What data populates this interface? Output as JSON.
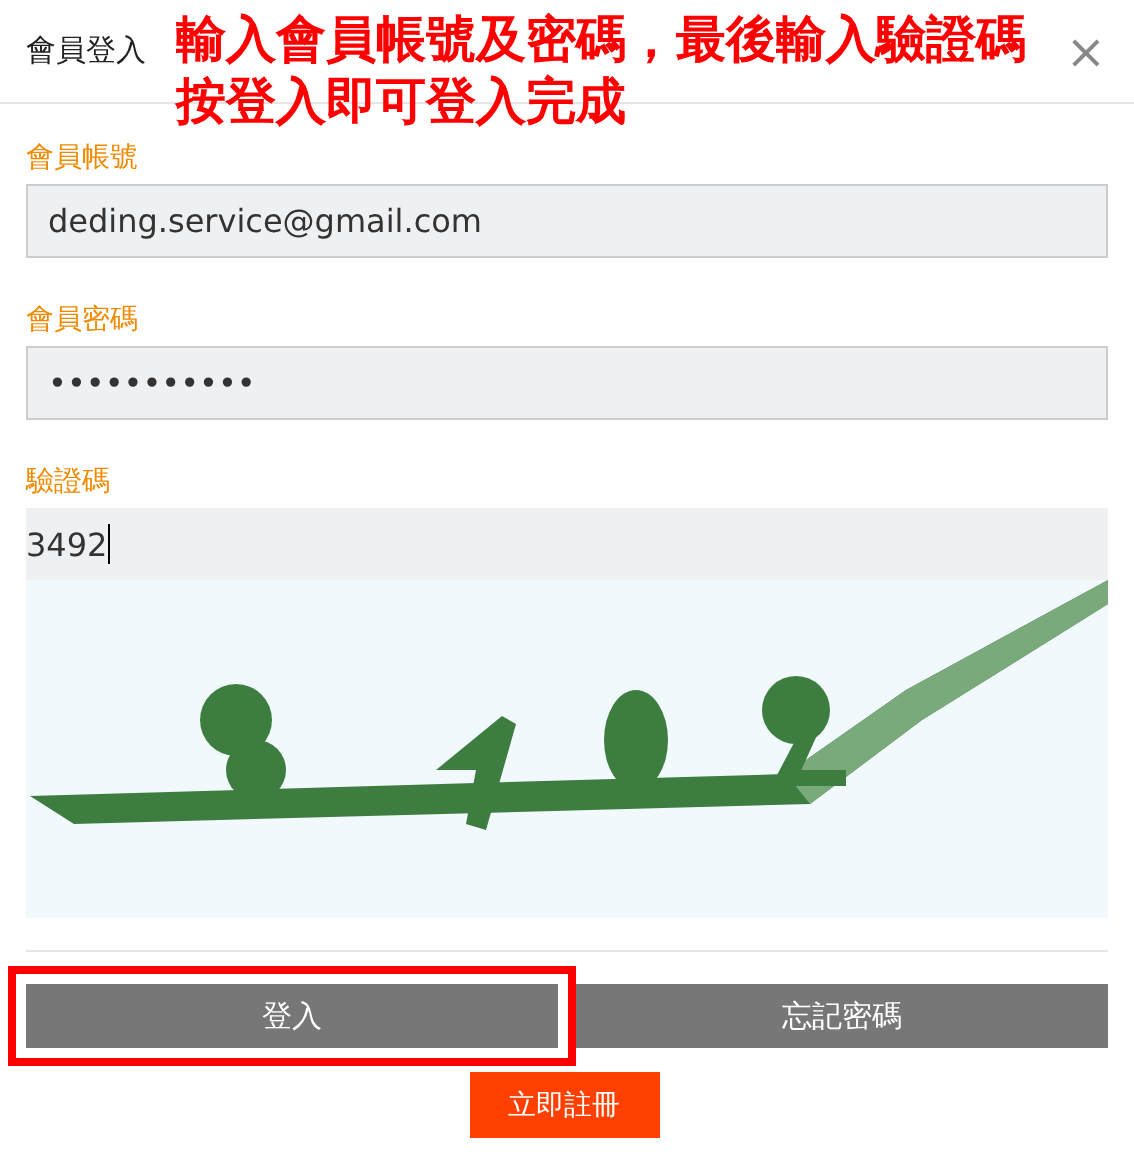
{
  "dialog": {
    "title": "會員登入",
    "close": "×"
  },
  "annotation": {
    "lines": [
      "輸入會員帳號及密碼，最後輸入驗證碼",
      "按登入即可登入完成"
    ]
  },
  "fields": [
    {
      "label": "會員帳號",
      "value": "deding.service@gmail.com",
      "kind": "text"
    },
    {
      "label": "會員密碼",
      "value": "•••••••••••",
      "kind": "text"
    },
    {
      "label": "驗證碼",
      "value": "3492",
      "kind": "captcha",
      "focused": true
    }
  ],
  "buttons": [
    {
      "label": "登入",
      "highlighted": true
    },
    {
      "label": "忘記密碼",
      "highlighted": false
    }
  ],
  "register": {
    "label": "立即註冊"
  }
}
